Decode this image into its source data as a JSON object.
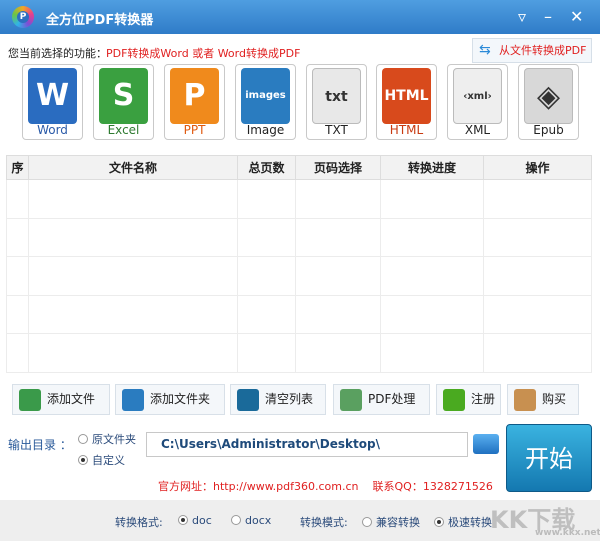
{
  "window": {
    "title": "全方位PDF转换器",
    "logo_letter": "P",
    "menu_icon": "▿",
    "minimize_icon": "–",
    "close_icon": "✕"
  },
  "function": {
    "label": "您当前选择的功能：",
    "value": "PDF转换成Word 或者 Word转换成PDF",
    "from_file_button": "从文件转换成PDF",
    "from_file_icon": "⇆"
  },
  "formats": [
    {
      "label": "Word",
      "glyph": "W",
      "color": "#2a6cc0",
      "text_color": "#2a5aa8"
    },
    {
      "label": "Excel",
      "glyph": "S",
      "color": "#3aa040",
      "text_color": "#2e7a30"
    },
    {
      "label": "PPT",
      "glyph": "P",
      "color": "#f08a1c",
      "text_color": "#e05a10"
    },
    {
      "label": "Image",
      "glyph": "images",
      "color": "#2a7cc0",
      "text_color": "#222"
    },
    {
      "label": "TXT",
      "glyph": "txt",
      "color": "#e8e8e8",
      "text_color": "#222"
    },
    {
      "label": "HTML",
      "glyph": "HTML",
      "color": "#d84a1c",
      "text_color": "#c83a10"
    },
    {
      "label": "XML",
      "glyph": "‹xml›",
      "color": "#eeeeee",
      "text_color": "#222"
    },
    {
      "label": "Epub",
      "glyph": "◈",
      "color": "#d8d8d8",
      "text_color": "#222"
    }
  ],
  "table": {
    "headers": [
      "序",
      "文件名称",
      "总页数",
      "页码选择",
      "转换进度",
      "操作"
    ],
    "rows": []
  },
  "toolbar": [
    {
      "label": "添加文件",
      "icon": "add-file"
    },
    {
      "label": "添加文件夹",
      "icon": "add-folder"
    },
    {
      "label": "清空列表",
      "icon": "trash"
    },
    {
      "label": "PDF处理",
      "icon": "document"
    },
    {
      "label": "注册",
      "icon": "check"
    },
    {
      "label": "购买",
      "icon": "shopping-bag"
    }
  ],
  "output": {
    "label": "输出目录 ：",
    "option_original": "原文件夹",
    "option_custom": "自定义",
    "path": "C:\\Users\\Administrator\\Desktop\\"
  },
  "start_button": "开始",
  "links": {
    "site": "官方网址：http://www.pdf360.com.cn",
    "qq": "联系QQ：1328271526"
  },
  "bottom": {
    "format_label": "转换格式:",
    "format_doc": "doc",
    "format_docx": "docx",
    "mode_label": "转换模式:",
    "mode_compat": "兼容转换",
    "mode_fast": "极速转换"
  },
  "watermark": {
    "text": "KK下载",
    "url": "www.kkx.net"
  }
}
